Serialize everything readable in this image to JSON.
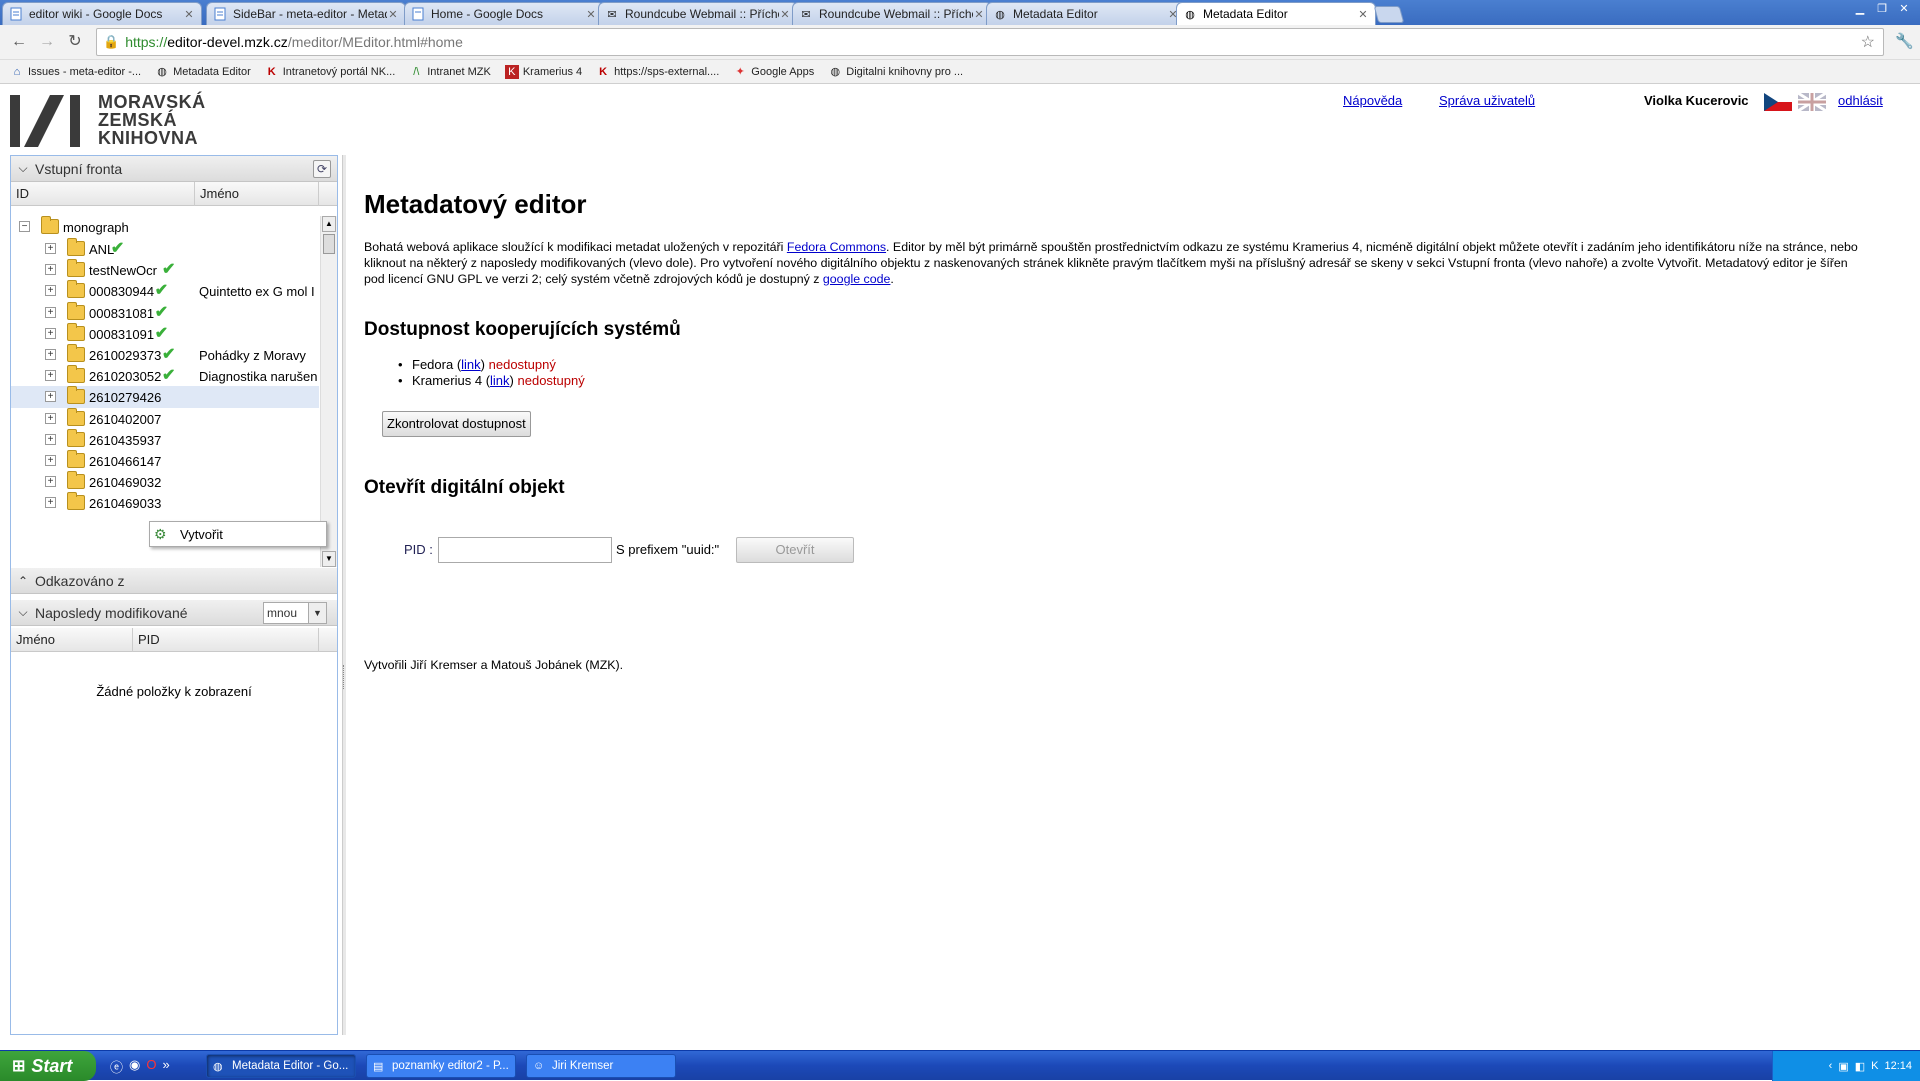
{
  "browser": {
    "tabs": [
      {
        "title": "editor wiki - Google Docs",
        "icon": "docs-icon",
        "active": false
      },
      {
        "title": "SideBar - meta-editor - Metad",
        "icon": "docs-icon",
        "active": false
      },
      {
        "title": "Home - Google Docs",
        "icon": "docs-icon",
        "active": false
      },
      {
        "title": "Roundcube Webmail :: Příchoz",
        "icon": "mail-icon",
        "active": false
      },
      {
        "title": "Roundcube Webmail :: Příchoz",
        "icon": "mail-icon",
        "active": false
      },
      {
        "title": "Metadata Editor",
        "icon": "globe-icon",
        "active": false
      },
      {
        "title": "Metadata Editor",
        "icon": "globe-icon",
        "active": true
      }
    ],
    "url": {
      "scheme": "https://",
      "host": "editor-devel.mzk.cz",
      "path": "/meditor/MEditor.html#home"
    },
    "bookmarks": [
      "Issues - meta-editor -...",
      "Metadata Editor",
      "Intranetový portál NK...",
      "Intranet MZK",
      "Kramerius 4",
      "https://sps-external....",
      "Google Apps",
      "Digitalni knihovny pro ..."
    ]
  },
  "header": {
    "logo_lines": [
      "MORAVSKÁ",
      "ZEMSKÁ",
      "KNIHOVNA"
    ],
    "help_link": "Nápověda",
    "users_link": "Správa uživatelů",
    "user_name": "Violka Kucerovic",
    "logout_link": "odhlásit"
  },
  "left_panel": {
    "input_queue": {
      "title": "Vstupní fronta",
      "columns": [
        "ID",
        "Jméno"
      ],
      "root": "monograph",
      "items": [
        {
          "id": "ANL",
          "name": "",
          "checked": true
        },
        {
          "id": "testNewOcr",
          "name": "",
          "checked": true
        },
        {
          "id": "000830944",
          "name": "Quintetto ex G mol I",
          "checked": true
        },
        {
          "id": "000831081",
          "name": "",
          "checked": true
        },
        {
          "id": "000831091",
          "name": "",
          "checked": true
        },
        {
          "id": "2610029373",
          "name": "Pohádky z Moravy",
          "checked": true
        },
        {
          "id": "2610203052",
          "name": "Diagnostika narušen",
          "checked": true
        },
        {
          "id": "2610279426",
          "name": "",
          "checked": false,
          "selected": true
        },
        {
          "id": "2610402007",
          "name": "",
          "checked": false
        },
        {
          "id": "2610435937",
          "name": "",
          "checked": false
        },
        {
          "id": "2610466147",
          "name": "",
          "checked": false
        },
        {
          "id": "2610469032",
          "name": "",
          "checked": false
        },
        {
          "id": "2610469033",
          "name": "",
          "checked": false
        }
      ]
    },
    "context_menu": {
      "label": "Vytvořit"
    },
    "referenced_from": {
      "title": "Odkazováno z"
    },
    "recently_modified": {
      "title": "Naposledy modifikované",
      "filter_value": "mnou",
      "columns": [
        "Jméno",
        "PID"
      ],
      "empty_message": "Žádné položky k zobrazení"
    }
  },
  "main": {
    "title": "Metadatový editor",
    "intro_1": "Bohatá webová aplikace sloužící k modifikaci metadat uložených v repozitáři ",
    "intro_link_fedora": "Fedora Commons",
    "intro_2": ". Editor by měl být primárně spouštěn prostřednictvím odkazu ze systému Kramerius 4, nicméně digitální objekt můžete otevřít i zadáním jeho identifikátoru níže na stránce, nebo kliknout na některý z naposledy modifikovaných (vlevo dole). Pro vytvoření nového digitálního objektu z naskenovaných stránek klikněte pravým tlačítkem myši na příslušný adresář se skeny v sekci Vstupní fronta (vlevo nahoře) a zvolte Vytvořit. Metadatový editor je šířen pod licencí GNU GPL ve verzi 2; celý systém včetně zdrojových kódů je dostupný z ",
    "intro_link_code": "google code",
    "intro_3": ".",
    "availability_title": "Dostupnost kooperujících systémů",
    "systems": [
      {
        "name": "Fedora",
        "link": "link",
        "status": "nedostupný"
      },
      {
        "name": "Kramerius 4",
        "link": "link",
        "status": "nedostupný"
      }
    ],
    "check_button": "Zkontrolovat dostupnost",
    "open_title": "Otevřít digitální objekt",
    "pid_label": "PID :",
    "pid_value": "",
    "pid_prefix_note": "S prefixem \"uuid:\"",
    "open_button": "Otevřít",
    "credits": "Vytvořili Jiří Kremser a Matouš Jobánek (MZK)."
  },
  "taskbar": {
    "start": "Start",
    "buttons": [
      {
        "label": "Metadata Editor - Go...",
        "active": true
      },
      {
        "label": "poznamky editor2 - P...",
        "active": false
      },
      {
        "label": "Jiri Kremser",
        "active": false
      }
    ],
    "lang": "CS",
    "clock": "12:14"
  },
  "colors": {
    "link": "#0000cc",
    "unavailable": "#bb0000",
    "panel_border": "#99bbe8",
    "taskbar": "#1c49b8"
  }
}
